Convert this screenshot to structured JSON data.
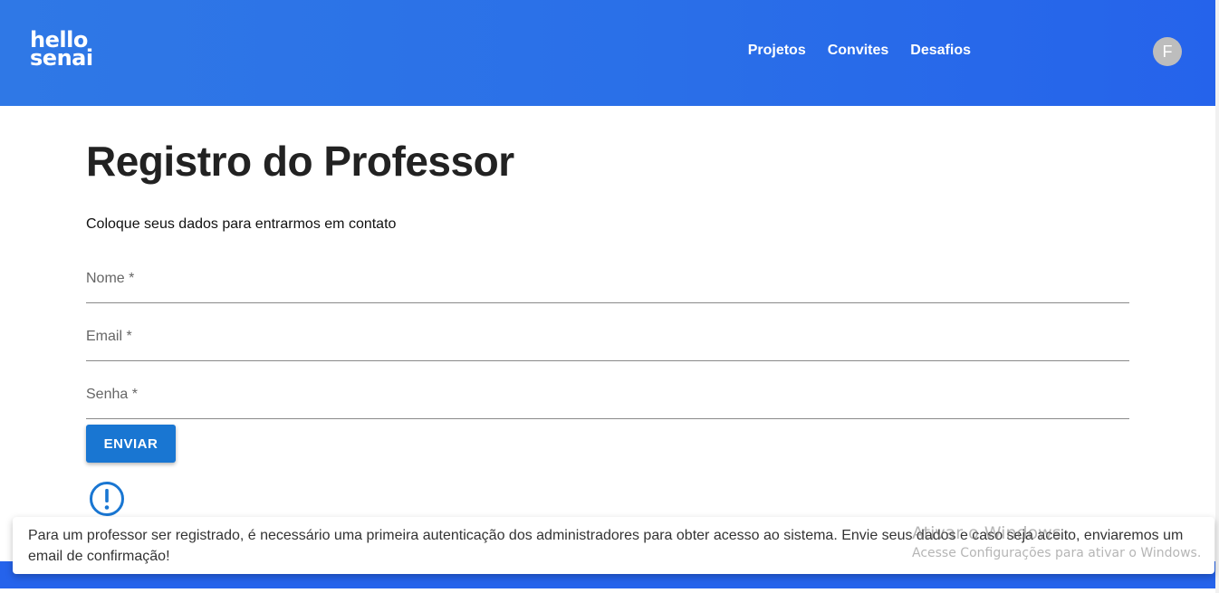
{
  "header": {
    "logo_line1": "hello",
    "logo_line2": "senai",
    "nav": [
      "Projetos",
      "Convites",
      "Desafios"
    ],
    "avatar_initial": "F"
  },
  "main": {
    "title": "Registro do Professor",
    "subtitle": "Coloque seus dados para entrarmos em contato",
    "fields": [
      {
        "label": "Nome *",
        "value": ""
      },
      {
        "label": "Email *",
        "value": ""
      },
      {
        "label": "Senha *",
        "value": ""
      }
    ],
    "submit_label": "ENVIAR"
  },
  "toast": {
    "message": "Para um professor ser registrado, é necessário uma primeira autenticação dos administradores para obter acesso ao sistema. Envie seus dados e caso seja aceito, enviaremos um email de confirmação!"
  },
  "watermark": {
    "line1": "Ativar o Windows",
    "line2": "Acesse Configurações para ativar o Windows."
  },
  "colors": {
    "appbar": "#2a6fe8",
    "primary": "#1976d2"
  }
}
